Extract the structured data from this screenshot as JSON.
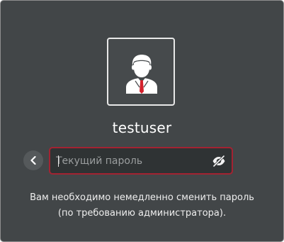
{
  "user": {
    "avatar_icon": "user-avatar-icon",
    "username": "testuser"
  },
  "back_button": {
    "icon": "chevron-left-icon"
  },
  "password": {
    "value": "",
    "placeholder": "Текущий пароль",
    "toggle_icon": "eye-slash-icon"
  },
  "message": {
    "line1": "Вам необходимо немедленно сменить пароль",
    "line2": "(по требованию администратора)."
  },
  "colors": {
    "background": "#424648",
    "field_border_error": "#a32332",
    "avatar_border": "#e8e8e8",
    "tie": "#d3202c"
  }
}
